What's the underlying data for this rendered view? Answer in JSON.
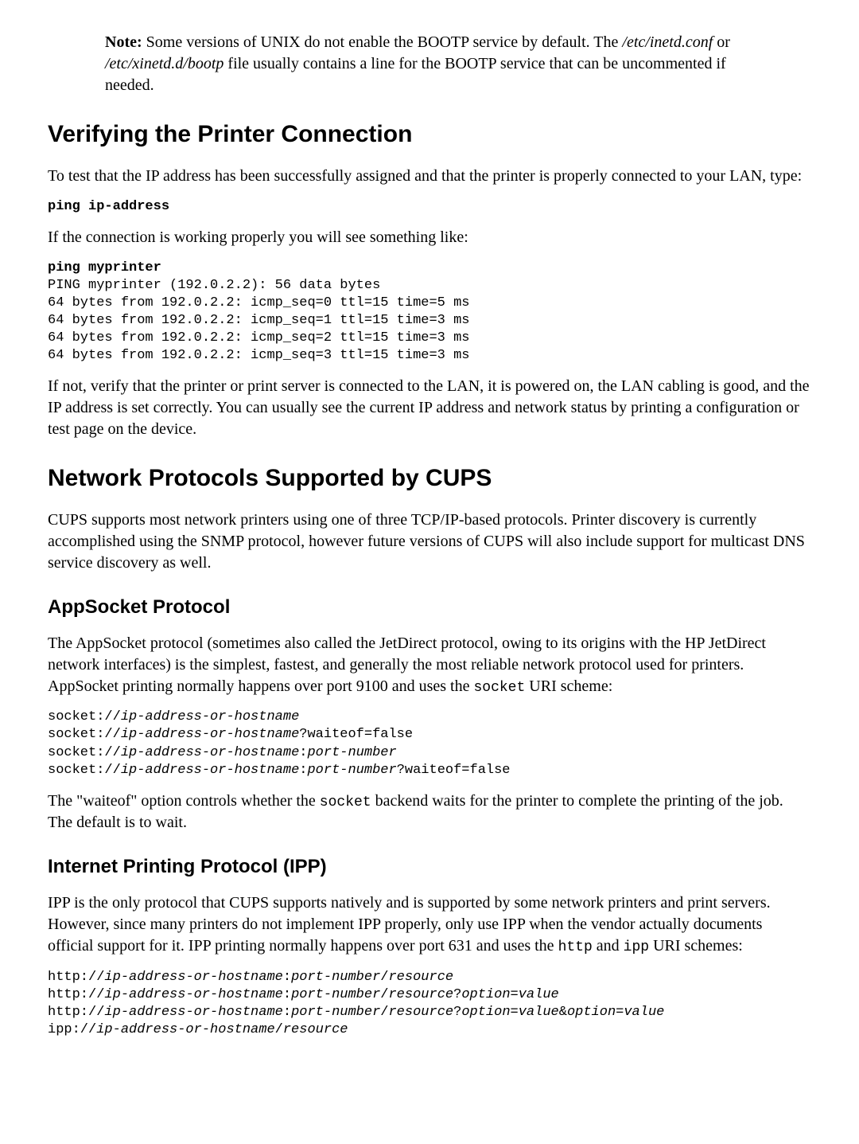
{
  "note": {
    "label": "Note:",
    "before_path1": " Some versions of UNIX do not enable the BOOTP service by default. The ",
    "path1": "/etc/inetd.conf",
    "between_paths": " or ",
    "path2": "/etc/xinetd.d/bootp",
    "after_path2": " file usually contains a line for the BOOTP service that can be uncommented if needed."
  },
  "verify": {
    "heading": "Verifying the Printer Connection",
    "intro": "To test that the IP address has been successfully assigned and that the printer is properly connected to your LAN, type:",
    "cmd1": "ping ip-address",
    "working_intro": "If the connection is working properly you will see something like:",
    "cmd2": "ping myprinter",
    "output1": "PING myprinter (192.0.2.2): 56 data bytes",
    "output2": "64 bytes from 192.0.2.2: icmp_seq=0 ttl=15 time=5 ms",
    "output3": "64 bytes from 192.0.2.2: icmp_seq=1 ttl=15 time=3 ms",
    "output4": "64 bytes from 192.0.2.2: icmp_seq=2 ttl=15 time=3 ms",
    "output5": "64 bytes from 192.0.2.2: icmp_seq=3 ttl=15 time=3 ms",
    "outro": "If not, verify that the printer or print server is connected to the LAN, it is powered on, the LAN cabling is good, and the IP address is set correctly. You can usually see the current IP address and network status by printing a configuration or test page on the device."
  },
  "protocols": {
    "heading": "Network Protocols Supported by CUPS",
    "intro": "CUPS supports most network printers using one of three TCP/IP-based protocols. Printer discovery is currently accomplished using the SNMP protocol, however future versions of CUPS will also include support for multicast DNS service discovery as well."
  },
  "appsocket": {
    "heading": "AppSocket Protocol",
    "para_part1": "The AppSocket protocol (sometimes also called the JetDirect protocol, owing to its origins with the HP JetDirect network interfaces) is the simplest, fastest, and generally the most reliable network protocol used for printers. AppSocket printing normally happens over port 9100 and uses the ",
    "code1": "socket",
    "para_part2": " URI scheme:",
    "uri1_prefix": "socket://",
    "uri1_host": "ip-address-or-hostname",
    "uri2_prefix": "socket://",
    "uri2_host": "ip-address-or-hostname",
    "uri2_suffix": "?waiteof=false",
    "uri3_prefix": "socket://",
    "uri3_host": "ip-address-or-hostname",
    "uri3_colon": ":",
    "uri3_port": "port-number",
    "uri4_prefix": "socket://",
    "uri4_host": "ip-address-or-hostname",
    "uri4_colon": ":",
    "uri4_port": "port-number",
    "uri4_suffix": "?waiteof=false",
    "waiteof_part1": "The \"waiteof\" option controls whether the ",
    "waiteof_code": "socket",
    "waiteof_part2": " backend waits for the printer to complete the printing of the job. The default is to wait."
  },
  "ipp": {
    "heading": "Internet Printing Protocol (IPP)",
    "para_part1": "IPP is the only protocol that CUPS supports natively and is supported by some network printers and print servers. However, since many printers do not implement IPP properly, only use IPP when the vendor actually documents official support for it. IPP printing normally happens over port 631 and uses the ",
    "code1": "http",
    "para_mid": " and ",
    "code2": "ipp",
    "para_part2": " URI schemes:",
    "u1_pre": "http://",
    "u1_host": "ip-address-or-hostname",
    "u1_c1": ":",
    "u1_port": "port-number",
    "u1_c2": "/",
    "u1_res": "resource",
    "u2_pre": "http://",
    "u2_host": "ip-address-or-hostname",
    "u2_c1": ":",
    "u2_port": "port-number",
    "u2_c2": "/",
    "u2_res": "resource",
    "u2_c3": "?",
    "u2_opt": "option=value",
    "u3_pre": "http://",
    "u3_host": "ip-address-or-hostname",
    "u3_c1": ":",
    "u3_port": "port-number",
    "u3_c2": "/",
    "u3_res": "resource",
    "u3_c3": "?",
    "u3_opt1": "option=value",
    "u3_amp": "&",
    "u3_opt2": "option=value",
    "u4_pre": "ipp://",
    "u4_host": "ip-address-or-hostname",
    "u4_c1": "/",
    "u4_res": "resource"
  }
}
